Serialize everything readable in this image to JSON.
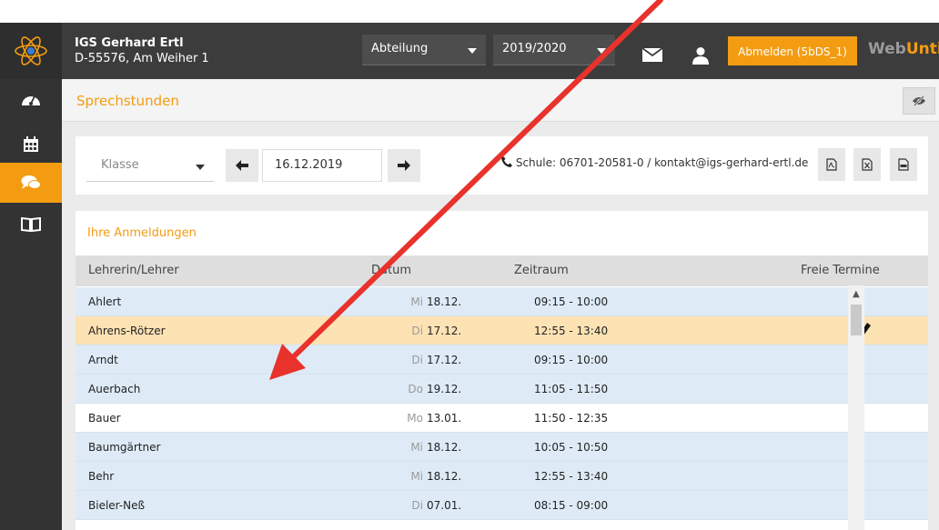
{
  "header": {
    "school_name": "IGS Gerhard Ertl",
    "school_address": "D-55576, Am Weiher 1",
    "department_select": "Abteilung",
    "year_select": "2019/2020",
    "logout_label": "Abmelden (5bDS_1)",
    "brand_part1": "Web",
    "brand_part2": "Untis"
  },
  "page": {
    "title": "Sprechstunden"
  },
  "toolbar": {
    "class_select": "Klasse",
    "date": "16.12.2019",
    "contact": "Schule: 06701-20581-0 / kontakt@igs-gerhard-ertl.de"
  },
  "panel": {
    "title": "Ihre Anmeldungen",
    "columns": {
      "teacher": "Lehrerin/Lehrer",
      "date": "Datum",
      "time": "Zeitraum",
      "free": "Freie Termine"
    },
    "rows": [
      {
        "name": "Ahlert",
        "day": "Mi",
        "date": "18.12.",
        "time": "09:15 - 10:00"
      },
      {
        "name": "Ahrens-Rötzer",
        "day": "Di",
        "date": "17.12.",
        "time": "12:55 - 13:40"
      },
      {
        "name": "Arndt",
        "day": "Di",
        "date": "17.12.",
        "time": "09:15 - 10:00"
      },
      {
        "name": "Auerbach",
        "day": "Do",
        "date": "19.12.",
        "time": "11:05 - 11:50"
      },
      {
        "name": "Bauer",
        "day": "Mo",
        "date": "13.01.",
        "time": "11:50 - 12:35"
      },
      {
        "name": "Baumgärtner",
        "day": "Mi",
        "date": "18.12.",
        "time": "10:05 - 10:50"
      },
      {
        "name": "Behr",
        "day": "Mi",
        "date": "18.12.",
        "time": "12:55 - 13:40"
      },
      {
        "name": "Bieler-Neß",
        "day": "Di",
        "date": "07.01.",
        "time": "08:15 - 09:00"
      }
    ]
  },
  "colors": {
    "accent": "#f39c12",
    "header_bg": "#3c3c3c",
    "available_dot": "#22cc22",
    "selected_row": "#fde2b4",
    "annotation_arrow": "#e8322b"
  }
}
